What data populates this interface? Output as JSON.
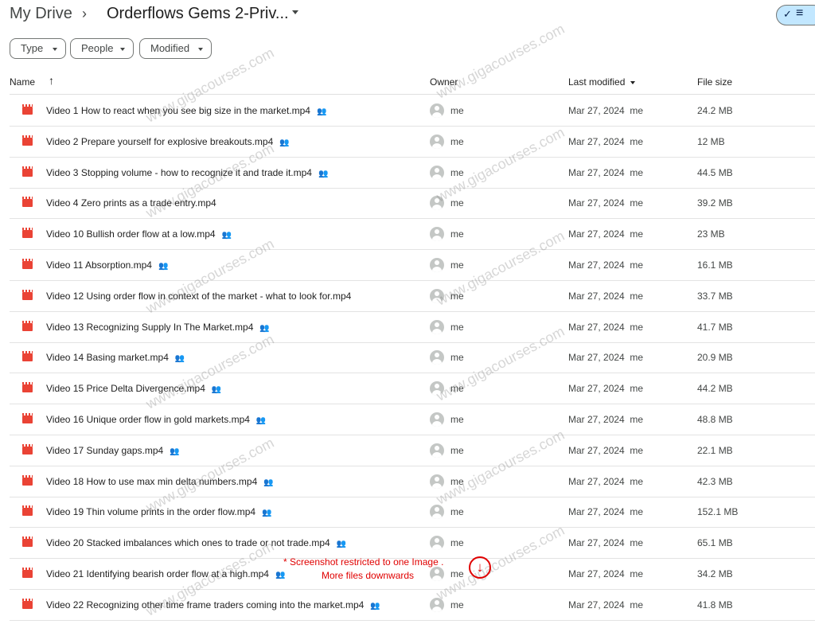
{
  "breadcrumb": {
    "root": "My Drive",
    "separator": "›",
    "folder": "Orderflows Gems 2-Priv..."
  },
  "view_toggle": {
    "check_icon": "✓",
    "list_icon": "≡"
  },
  "filters": [
    {
      "label": "Type"
    },
    {
      "label": "People"
    },
    {
      "label": "Modified"
    }
  ],
  "columns": {
    "name": "Name",
    "sort_icon": "↑",
    "owner": "Owner",
    "last_modified": "Last modified",
    "file_size": "File size"
  },
  "files": [
    {
      "name": "Video 1 How to react when you see big size in the market.mp4",
      "shared": true,
      "owner": "me",
      "modified": "Mar 27, 2024  me",
      "size": "24.2 MB"
    },
    {
      "name": "Video 2 Prepare yourself for explosive breakouts.mp4",
      "shared": true,
      "owner": "me",
      "modified": "Mar 27, 2024  me",
      "size": "12 MB"
    },
    {
      "name": "Video 3 Stopping volume - how to recognize it and trade it.mp4",
      "shared": true,
      "owner": "me",
      "modified": "Mar 27, 2024  me",
      "size": "44.5 MB"
    },
    {
      "name": "Video 4 Zero prints as a trade entry.mp4",
      "shared": false,
      "owner": "me",
      "modified": "Mar 27, 2024  me",
      "size": "39.2 MB"
    },
    {
      "name": "Video 10 Bullish order flow at a low.mp4",
      "shared": true,
      "owner": "me",
      "modified": "Mar 27, 2024  me",
      "size": "23 MB"
    },
    {
      "name": "Video 11 Absorption.mp4",
      "shared": true,
      "owner": "me",
      "modified": "Mar 27, 2024  me",
      "size": "16.1 MB"
    },
    {
      "name": "Video 12 Using order flow in context of the market - what to look for.mp4",
      "shared": false,
      "owner": "me",
      "modified": "Mar 27, 2024  me",
      "size": "33.7 MB"
    },
    {
      "name": "Video 13 Recognizing Supply In The Market.mp4",
      "shared": true,
      "owner": "me",
      "modified": "Mar 27, 2024  me",
      "size": "41.7 MB"
    },
    {
      "name": "Video 14 Basing market.mp4",
      "shared": true,
      "owner": "me",
      "modified": "Mar 27, 2024  me",
      "size": "20.9 MB"
    },
    {
      "name": "Video 15 Price Delta Divergence.mp4",
      "shared": true,
      "owner": "me",
      "modified": "Mar 27, 2024  me",
      "size": "44.2 MB"
    },
    {
      "name": "Video 16 Unique order flow in gold markets.mp4",
      "shared": true,
      "owner": "me",
      "modified": "Mar 27, 2024  me",
      "size": "48.8 MB"
    },
    {
      "name": "Video 17 Sunday gaps.mp4",
      "shared": true,
      "owner": "me",
      "modified": "Mar 27, 2024  me",
      "size": "22.1 MB"
    },
    {
      "name": "Video 18 How to use max min delta numbers.mp4",
      "shared": true,
      "owner": "me",
      "modified": "Mar 27, 2024  me",
      "size": "42.3 MB"
    },
    {
      "name": "Video 19 Thin volume prints in the order flow.mp4",
      "shared": true,
      "owner": "me",
      "modified": "Mar 27, 2024  me",
      "size": "152.1 MB"
    },
    {
      "name": "Video 20 Stacked imbalances which ones to trade or not trade.mp4",
      "shared": true,
      "owner": "me",
      "modified": "Mar 27, 2024  me",
      "size": "65.1 MB"
    },
    {
      "name": "Video 21 Identifying bearish order flow at a high.mp4",
      "shared": true,
      "owner": "me",
      "modified": "Mar 27, 2024  me",
      "size": "34.2 MB"
    },
    {
      "name": "Video 22 Recognizing other time frame traders coming into the market.mp4",
      "shared": true,
      "owner": "me",
      "modified": "Mar 27, 2024  me",
      "size": "41.8 MB"
    }
  ],
  "shared_icon": "👥",
  "note": {
    "line1": "* Screenshot restricted to one Image .",
    "line2": "More files downwards",
    "icon": "↓"
  },
  "watermark": "www.gigacourses.com"
}
